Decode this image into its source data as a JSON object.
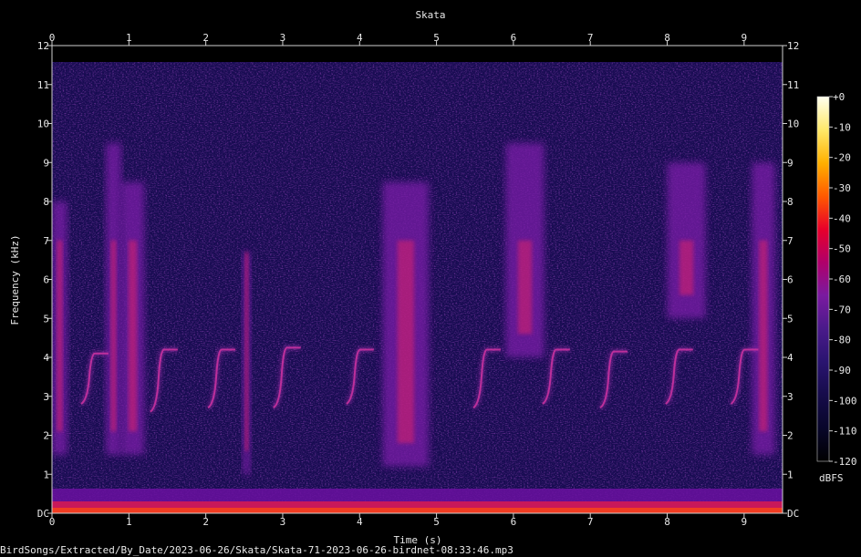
{
  "chart_data": {
    "type": "heatmap",
    "title": "Skata",
    "xlabel": "Time (s)",
    "ylabel": "Frequency (kHz)",
    "xlim": [
      0,
      9.5
    ],
    "ylim": [
      0,
      12
    ],
    "x_ticks": [
      "0",
      "1",
      "2",
      "3",
      "4",
      "5",
      "6",
      "7",
      "8",
      "9"
    ],
    "y_ticks": [
      "DC",
      "1",
      "2",
      "3",
      "4",
      "5",
      "6",
      "7",
      "8",
      "9",
      "10",
      "11",
      "12"
    ],
    "colorbar": {
      "label": "dBFS",
      "range": [
        -120,
        0
      ],
      "ticks": [
        "+0",
        "-10",
        "-20",
        "-30",
        "-40",
        "-50",
        "-60",
        "-70",
        "-80",
        "-90",
        "-100",
        "-110",
        "-120"
      ],
      "colors": [
        "#fffff0",
        "#ffe96a",
        "#ffb000",
        "#ff5a00",
        "#e8002a",
        "#b0006a",
        "#7a1aa0",
        "#4a1a8a",
        "#2a1470",
        "#160c4a",
        "#08062a",
        "#000000"
      ]
    },
    "grid": false,
    "annotations": {
      "chirps": [
        {
          "t": 0.45,
          "f_low": 2.9,
          "f_high": 4.1
        },
        {
          "t": 1.35,
          "f_low": 2.7,
          "f_high": 4.2
        },
        {
          "t": 2.1,
          "f_low": 2.8,
          "f_high": 4.2
        },
        {
          "t": 2.95,
          "f_low": 2.8,
          "f_high": 4.25
        },
        {
          "t": 3.9,
          "f_low": 2.9,
          "f_high": 4.2
        },
        {
          "t": 5.55,
          "f_low": 2.8,
          "f_high": 4.2
        },
        {
          "t": 6.45,
          "f_low": 2.9,
          "f_high": 4.2
        },
        {
          "t": 7.2,
          "f_low": 2.8,
          "f_high": 4.15
        },
        {
          "t": 8.05,
          "f_low": 2.9,
          "f_high": 4.2
        },
        {
          "t": 8.9,
          "f_low": 2.9,
          "f_high": 4.2
        }
      ],
      "broadband_calls": [
        {
          "t_start": 0.0,
          "t_end": 0.2,
          "f_low": 1.5,
          "f_high": 8.0
        },
        {
          "t_start": 0.7,
          "t_end": 0.9,
          "f_low": 1.5,
          "f_high": 9.5
        },
        {
          "t_start": 0.9,
          "t_end": 1.2,
          "f_low": 1.5,
          "f_high": 8.5
        },
        {
          "t_start": 2.48,
          "t_end": 2.58,
          "f_low": 1.0,
          "f_high": 6.7
        },
        {
          "t_start": 4.3,
          "t_end": 4.9,
          "f_low": 1.2,
          "f_high": 8.5
        },
        {
          "t_start": 5.9,
          "t_end": 6.4,
          "f_low": 4.0,
          "f_high": 9.5
        },
        {
          "t_start": 8.0,
          "t_end": 8.5,
          "f_low": 5.0,
          "f_high": 9.0
        },
        {
          "t_start": 9.1,
          "t_end": 9.4,
          "f_low": 1.5,
          "f_high": 9.0
        }
      ]
    }
  },
  "footer": {
    "file_path": "BirdSongs/Extracted/By_Date/2023-06-26/Skata/Skata-71-2023-06-26-birdnet-08:33:46.mp3"
  }
}
